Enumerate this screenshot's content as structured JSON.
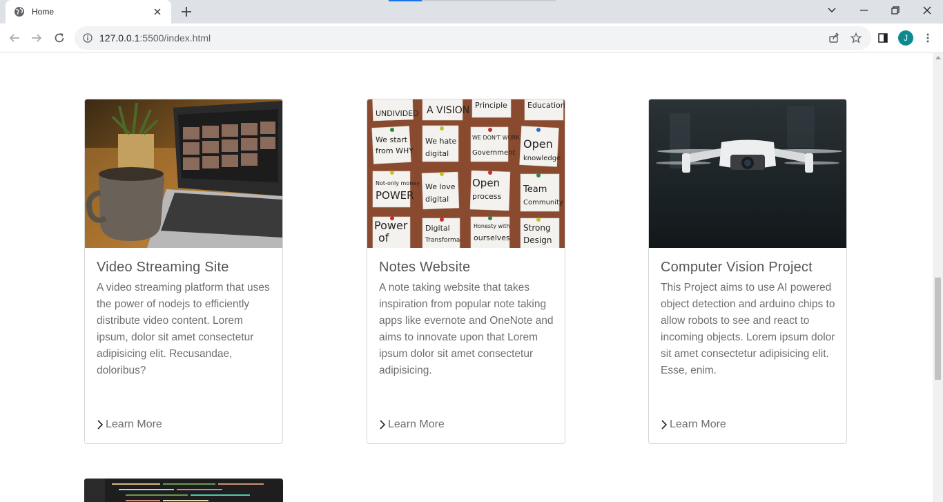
{
  "browser": {
    "tab_title": "Home",
    "url_host": "127.0.0.1",
    "url_rest": ":5500/index.html",
    "profile_initial": "J"
  },
  "cards": [
    {
      "title": "Video Streaming Site",
      "text": "A video streaming platform that uses the power of nodejs to efficiently distribute video content. Lorem ipsum, dolor sit amet consectetur adipisicing elit. Recusandae, doloribus?",
      "link": "Learn More",
      "image": "laptop-video-call-with-coffee-cup"
    },
    {
      "title": "Notes Website",
      "text": "A note taking website that takes inspiration from popular note taking apps like evernote and OneNote and aims to innovate upon that Lorem ipsum dolor sit amet consectetur adipisicing.",
      "link": "Learn More",
      "image": "sticky-notes-on-corkboard"
    },
    {
      "title": "Computer Vision Project",
      "text": "This Project aims to use AI powered object detection and arduino chips to allow robots to see and react to incoming objects. Lorem ipsum dolor sit amet consectetur adipisicing elit. Esse, enim.",
      "link": "Learn More",
      "image": "white-drone-in-flight"
    }
  ],
  "partial_card": {
    "image": "code-editor-screenshot"
  }
}
